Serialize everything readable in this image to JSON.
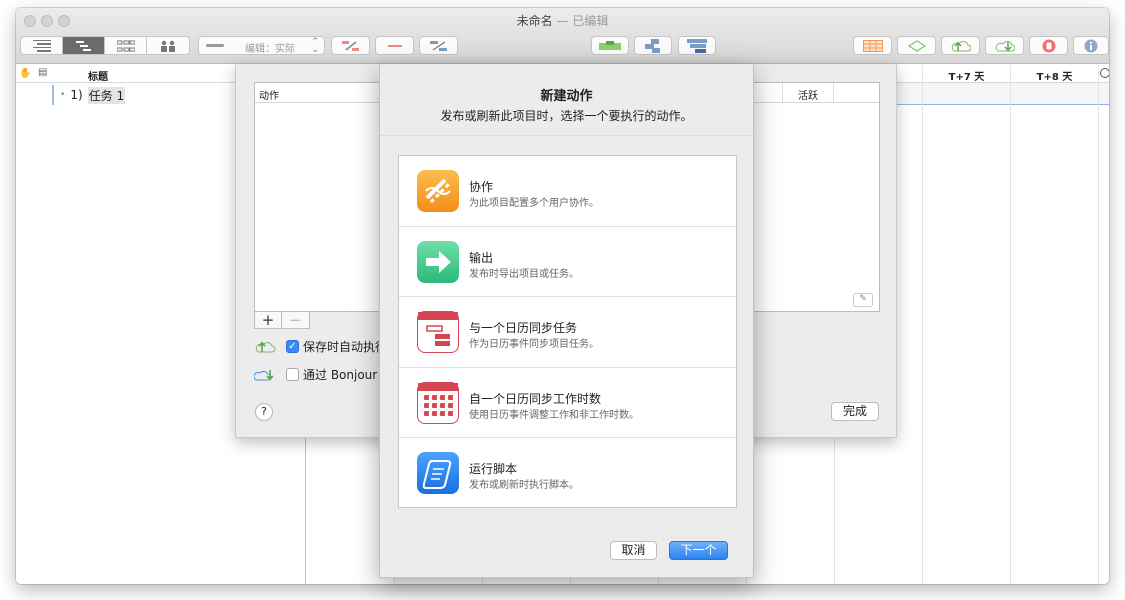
{
  "window": {
    "title": "未命名",
    "status": "— 已编辑"
  },
  "toolbar": {
    "edit_mode_label": "编辑：实际",
    "icons": [
      "outline-view-icon",
      "gantt-view-icon",
      "network-view-icon",
      "resource-view-icon",
      "link-icon",
      "unlink-icon",
      "split-icon",
      "level-icon",
      "group-icon",
      "subgroup-icon",
      "table-icon",
      "baseline-icon",
      "publish-icon",
      "refresh-icon",
      "stop-icon",
      "info-icon"
    ]
  },
  "outline": {
    "column_title": "标题",
    "row": {
      "number": "1)",
      "name": "任务 1"
    }
  },
  "gantt": {
    "day_headers": [
      "T+7 天",
      "T+8 天"
    ]
  },
  "sheet": {
    "column_action": "动作",
    "column_active": "活跃",
    "option_autosave": "保存时自动执行",
    "option_bonjour": "通过 Bonjour 远",
    "autosave_checked": true,
    "bonjour_checked": false,
    "add_glyph": "+",
    "remove_glyph": "−",
    "help_glyph": "?",
    "done_label": "完成"
  },
  "dialog": {
    "title": "新建动作",
    "subtitle": "发布或刷新此项目时，选择一个要执行的动作。",
    "actions": [
      {
        "name": "协作",
        "desc": "为此项目配置多个用户协作。",
        "icon": "collaborate-icon",
        "color": "#f7a52d"
      },
      {
        "name": "输出",
        "desc": "发布时导出项目或任务。",
        "icon": "export-arrow-icon",
        "color": "#3ec98c"
      },
      {
        "name": "与一个日历同步任务",
        "desc": "作为日历事件同步项目任务。",
        "icon": "calendar-tasks-icon",
        "color": "#d54552"
      },
      {
        "name": "自一个日历同步工作时数",
        "desc": "使用日历事件调整工作和非工作时数。",
        "icon": "calendar-grid-icon",
        "color": "#d54552"
      },
      {
        "name": "运行脚本",
        "desc": "发布或刷新时执行脚本。",
        "icon": "script-scroll-icon",
        "color": "#2b86f0"
      }
    ],
    "cancel_label": "取消",
    "next_label": "下一个"
  }
}
